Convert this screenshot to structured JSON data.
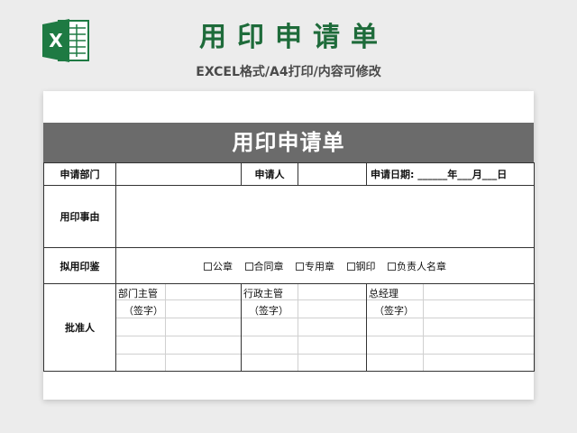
{
  "header": {
    "title": "用印申请单",
    "subtitle": "EXCEL格式/A4打印/内容可修改"
  },
  "logo": {
    "letter": "X",
    "color": "#1e7a43"
  },
  "form": {
    "title": "用印申请单",
    "dept_label": "申请部门",
    "dept_value": "",
    "applicant_label": "申请人",
    "applicant_value": "",
    "date_text": "申请日期: ______年___月___日",
    "reason_label": "用印事由",
    "reason_value": "",
    "seal_label": "拟用印鉴",
    "seals": [
      "公章",
      "合同章",
      "专用章",
      "钢印",
      "负责人名章"
    ],
    "approver_label": "批准人",
    "approvers": [
      {
        "role": "部门主管",
        "sign": "（签字）"
      },
      {
        "role": "行政主管",
        "sign": "（签字）"
      },
      {
        "role": "总经理",
        "sign": "（签字）"
      }
    ]
  }
}
